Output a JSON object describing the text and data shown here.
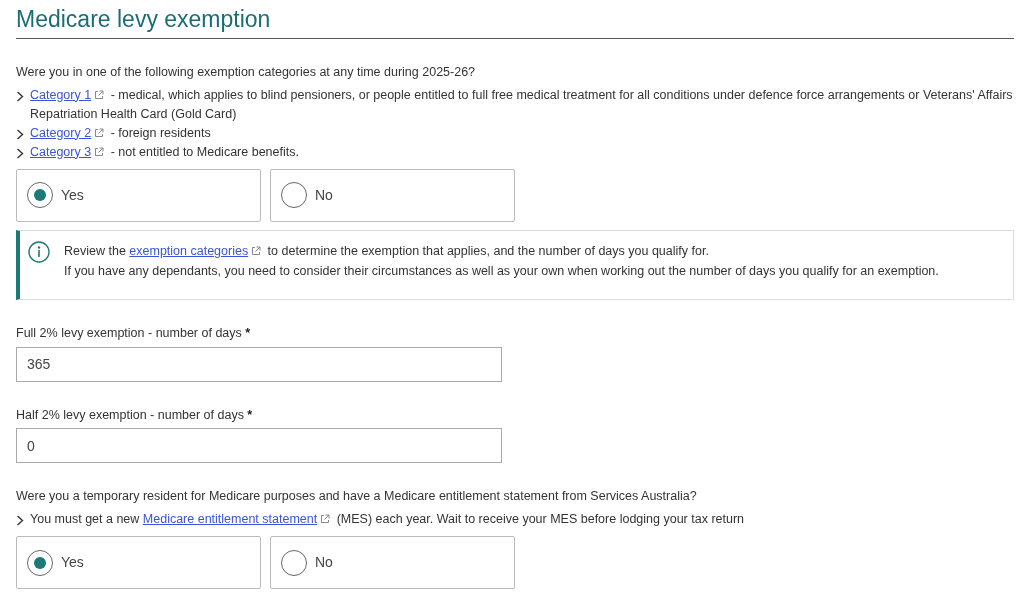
{
  "title": "Medicare levy exemption",
  "question_1": {
    "text": "Were you in one of the following exemption categories at any time during 2025-26?",
    "items": [
      {
        "link": "Category 1",
        "text": "- medical, which applies to blind pensioners, or people entitled to full free medical treatment for all conditions under defence force arrangements or Veterans' Affairs Repatriation Health Card (Gold Card)"
      },
      {
        "link": "Category 2",
        "text": "- foreign residents"
      },
      {
        "link": "Category 3",
        "text": "- not entitled to Medicare benefits."
      }
    ],
    "options": [
      {
        "label": "Yes",
        "selected": true
      },
      {
        "label": "No",
        "selected": false
      }
    ]
  },
  "info": {
    "before": "Review the",
    "link": "exemption categories",
    "after": "to determine the exemption that applies, and the number of days you qualify for.",
    "note": "If you have any dependants, you need to consider their circumstances as well as your own when working out the number of days you qualify for an exemption."
  },
  "fields": [
    {
      "label": "Full 2% levy exemption - number of days",
      "required": "*",
      "value": "365"
    },
    {
      "label": "Half 2% levy exemption - number of days",
      "required": "*",
      "value": "0"
    }
  ],
  "question_2": {
    "text": "Were you a temporary resident for Medicare purposes and have a Medicare entitlement statement from Services Australia?",
    "items": [
      {
        "before": "You must get a new",
        "link": "Medicare entitlement statement",
        "text": "(MES) each year. Wait to receive your MES before lodging your tax return"
      }
    ],
    "options": [
      {
        "label": "Yes",
        "selected": true
      },
      {
        "label": "No",
        "selected": false
      }
    ]
  }
}
